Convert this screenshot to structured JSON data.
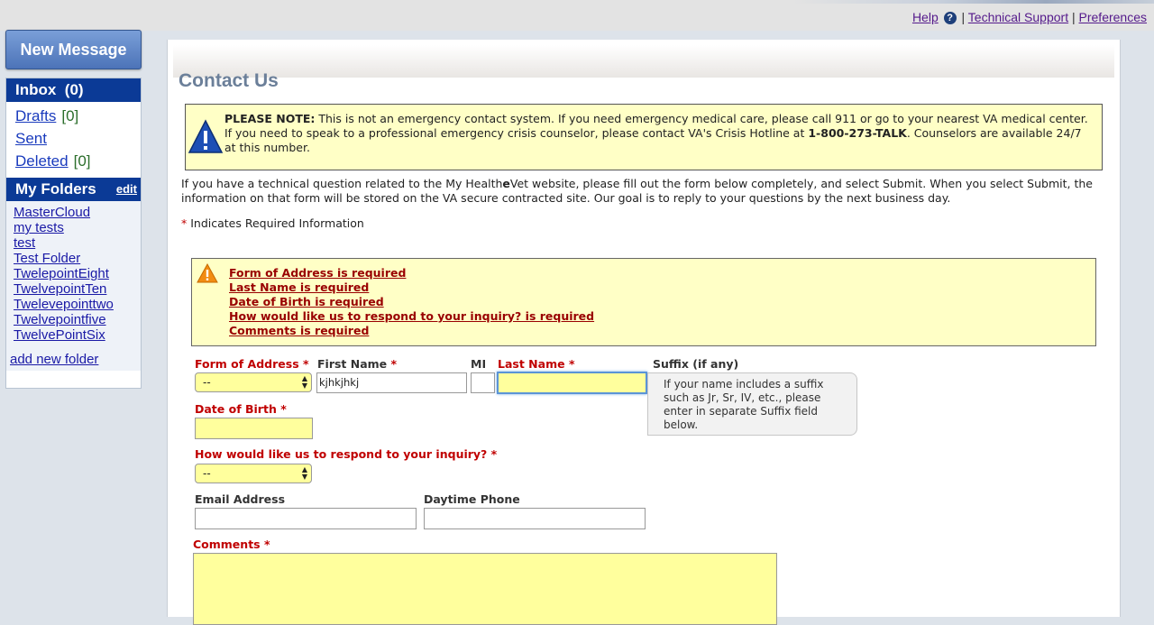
{
  "toplinks": {
    "help": "Help",
    "separator": "|",
    "technical_support": "Technical Support",
    "preferences": "Preferences",
    "help_icon": "?"
  },
  "sidebar": {
    "new_message": "New Message",
    "inbox_label": "Inbox",
    "inbox_count": "(0)",
    "mailboxes": [
      {
        "label": "Drafts",
        "count": "[0]"
      },
      {
        "label": "Sent",
        "count": ""
      },
      {
        "label": "Deleted",
        "count": "[0]"
      }
    ],
    "folders_title": "My Folders",
    "folders_edit": "edit",
    "folders": [
      "MasterCloud",
      "my tests",
      "test",
      "Test Folder",
      "TwelepointEight",
      "TwelvepointTen",
      "Twelevepointtwo",
      "Twelvepointfive",
      "TwelvePointSix"
    ],
    "add_folder": "add new folder"
  },
  "main": {
    "title": "Contact Us",
    "note_bold": "PLEASE NOTE:",
    "note_text_1": " This is not an emergency contact system. If you need emergency medical care, please call 911 or go to your nearest VA medical center. If you need to speak to a professional emergency crisis counselor, please contact VA's Crisis Hotline at ",
    "note_phone": "1-800-273-TALK",
    "note_text_2": ". Counselors are available 24/7 at this number.",
    "intro_1": "If you have a technical question related to the My Health",
    "intro_e": "e",
    "intro_2": "Vet website, please fill out the form below completely, and select Submit. When you select Submit, the information on that form will be stored on the VA secure contracted site. Our goal is to reply to your questions by the next business day.",
    "required_star": "*",
    "required_note": " Indicates Required Information",
    "errors": [
      "Form of Address is required",
      "Last Name is required",
      "Date of Birth is required",
      "How would like us to respond to your inquiry? is required",
      "Comments is required"
    ]
  },
  "form": {
    "form_of_address_label": "Form of Address",
    "form_of_address_value": "--",
    "first_name_label": "First Name",
    "first_name_value": "kjhkjhkj",
    "mi_label": "MI",
    "last_name_label": "Last Name",
    "suffix_label": "Suffix (if any)",
    "suffix_tooltip": "If your name includes a suffix such as Jr, Sr, IV, etc., please enter in separate Suffix field below.",
    "dob_label": "Date of Birth",
    "respond_label": "How would like us to respond to your inquiry?",
    "respond_value": "--",
    "email_label": "Email Address",
    "phone_label": "Daytime Phone",
    "comments_label": "Comments",
    "star": "*"
  },
  "colors": {
    "accent": "#0b3a96",
    "required": "#c00000",
    "error": "#990000",
    "highlight": "#ffff9d",
    "note_bg": "#ffffc6"
  }
}
